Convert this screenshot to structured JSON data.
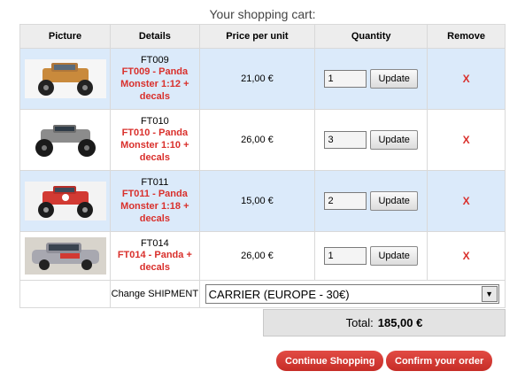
{
  "page": {
    "title": "Your shopping cart:"
  },
  "table": {
    "headers": [
      "Picture",
      "Details",
      "Price per unit",
      "Quantity",
      "Remove"
    ],
    "rows": [
      {
        "code": "FT009",
        "name": "FT009 - Panda Monster 1:12 + decals",
        "price": "21,00 €",
        "quantity": "1",
        "update_label": "Update",
        "remove_label": "X",
        "car_color": "#c98a3c"
      },
      {
        "code": "FT010",
        "name": "FT010 - Panda Monster 1:10 + decals",
        "price": "26,00 €",
        "quantity": "3",
        "update_label": "Update",
        "remove_label": "X",
        "car_color": "#8c8c8c"
      },
      {
        "code": "FT011",
        "name": "FT011 - Panda Monster 1:18 + decals",
        "price": "15,00 €",
        "quantity": "2",
        "update_label": "Update",
        "remove_label": "X",
        "car_color": "#d23a33"
      },
      {
        "code": "FT014",
        "name": "FT014 - Panda + decals",
        "price": "26,00 €",
        "quantity": "1",
        "update_label": "Update",
        "remove_label": "X",
        "car_color": "#a8a8b0"
      }
    ]
  },
  "shipment": {
    "label": "Change SHIPMENT",
    "selected": "CARRIER (EUROPE - 30€)"
  },
  "total": {
    "label": "Total:",
    "amount": "185,00 €"
  },
  "buttons": {
    "continue": "Continue Shopping",
    "confirm": "Confirm your order"
  },
  "colors": {
    "accent": "#d9302c",
    "row_highlight": "#dbeafa"
  }
}
